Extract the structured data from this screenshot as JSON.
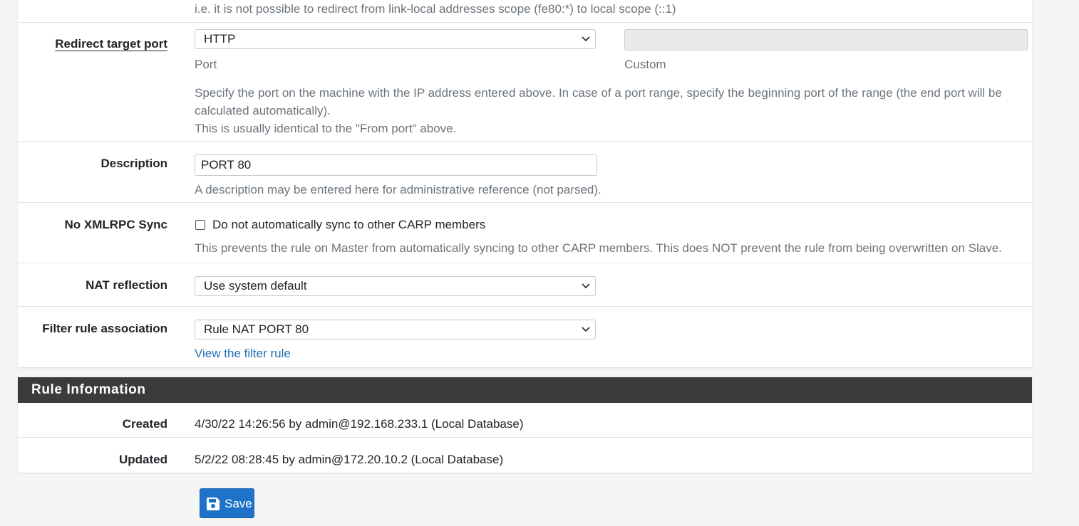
{
  "top_note": "i.e. it is not possible to redirect from link-local addresses scope (fe80:*) to local scope (::1)",
  "redirect_port": {
    "label": "Redirect target port",
    "port_value": "HTTP",
    "port_sublabel": "Port",
    "custom_sublabel": "Custom",
    "custom_value": "",
    "help_line1": "Specify the port on the machine with the IP address entered above. In case of a port range, specify the beginning port of the range (the end port will be",
    "help_line2": "calculated automatically).",
    "help_line3": "This is usually identical to the \"From port\" above."
  },
  "description": {
    "label": "Description",
    "value": "PORT 80",
    "help": "A description may be entered here for administrative reference (not parsed)."
  },
  "xmlrpc": {
    "label": "No XMLRPC Sync",
    "checkbox_label": "Do not automatically sync to other CARP members",
    "checked": false,
    "help": "This prevents the rule on Master from automatically syncing to other CARP members. This does NOT prevent the rule from being overwritten on Slave."
  },
  "nat_reflection": {
    "label": "NAT reflection",
    "value": "Use system default"
  },
  "filter_rule": {
    "label": "Filter rule association",
    "value": "Rule NAT PORT 80",
    "link": "View the filter rule"
  },
  "rule_info": {
    "title": "Rule Information",
    "created_label": "Created",
    "created_value": "4/30/22 14:26:56 by admin@192.168.233.1 (Local Database)",
    "updated_label": "Updated",
    "updated_value": "5/2/22 08:28:45 by admin@172.20.10.2 (Local Database)"
  },
  "save_button": {
    "label": "Save",
    "icon": "save-icon"
  },
  "colors": {
    "primary": "#1e73c8",
    "header_bg": "#3b3b3b",
    "link": "#1f6fb2"
  }
}
